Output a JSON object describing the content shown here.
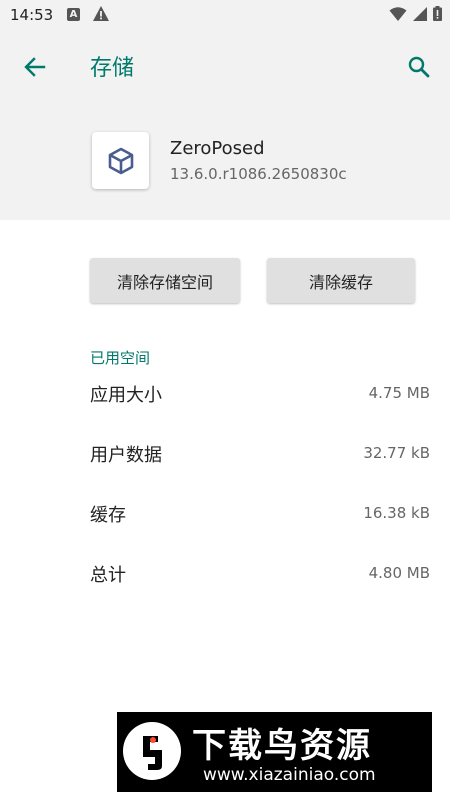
{
  "status_bar": {
    "time": "14:53",
    "a_badge": "A"
  },
  "app_bar": {
    "title": "存储"
  },
  "app_info": {
    "name": "ZeroPosed",
    "version": "13.6.0.r1086.2650830c"
  },
  "actions": {
    "clear_storage": "清除存储空间",
    "clear_cache": "清除缓存"
  },
  "storage": {
    "section_title": "已用空间",
    "rows": [
      {
        "label": "应用大小",
        "value": "4.75 MB"
      },
      {
        "label": "用户数据",
        "value": "32.77 kB"
      },
      {
        "label": "缓存",
        "value": "16.38 kB"
      },
      {
        "label": "总计",
        "value": "4.80 MB"
      }
    ]
  },
  "watermark": {
    "title": "下载鸟资源",
    "url": "www.xiazainiao.com"
  },
  "colors": {
    "accent": "#00796b",
    "background": "#f2f2f2",
    "button": "#e0e0e0",
    "app_icon": "#4a5d8f"
  },
  "icons": {
    "back": "arrow-back-icon",
    "search": "search-icon",
    "wifi": "wifi-icon",
    "signal": "signal-icon",
    "battery": "battery-icon",
    "warning": "warning-icon",
    "app": "cube-icon"
  }
}
